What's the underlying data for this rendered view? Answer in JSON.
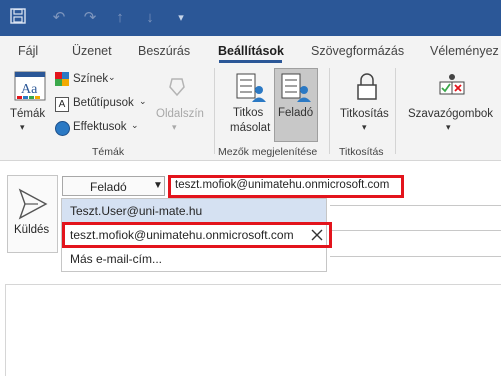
{
  "tabs": [
    {
      "label": "Fájl"
    },
    {
      "label": "Üzenet"
    },
    {
      "label": "Beszúrás"
    },
    {
      "label": "Beállítások"
    },
    {
      "label": "Szövegformázás"
    },
    {
      "label": "Véleményez"
    }
  ],
  "ribbon": {
    "temak": "Témák",
    "szinek": "Színek",
    "betutipusok": "Betűtípusok",
    "effektusok": "Effektusok",
    "oldalszin": "Oldalszín",
    "titkos_line1": "Titkos",
    "titkos_line2": "másolat",
    "felado": "Feladó",
    "titkositas": "Titkosítás",
    "szavazogombok": "Szavazógombok",
    "groups": {
      "temak": "Témák",
      "mezok": "Mezők megjelenítése",
      "titkositas": "Titkosítás"
    }
  },
  "compose": {
    "send_label": "Küldés",
    "from_button": "Feladó",
    "from_value": "teszt.mofiok@unimatehu.onmicrosoft.com",
    "dropdown": [
      "Teszt.User@uni-mate.hu",
      "teszt.mofiok@unimatehu.onmicrosoft.com",
      "Más e-mail-cím..."
    ]
  },
  "colors": {
    "titlebar": "#2b5797",
    "highlight": "#e3141c",
    "selected_item": "#d5e1f2"
  }
}
